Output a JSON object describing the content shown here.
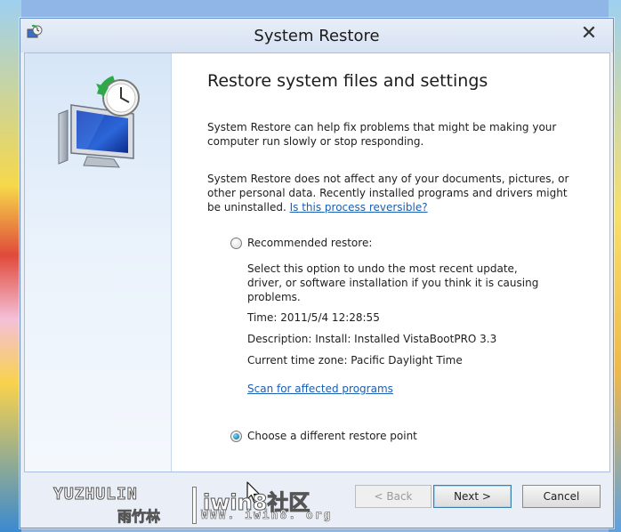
{
  "window": {
    "title": "System Restore",
    "close_label": "✕"
  },
  "main": {
    "heading": "Restore system files and settings",
    "paragraph1": "System Restore can help fix problems that might be making your computer run slowly or stop responding.",
    "paragraph2": "System Restore does not affect any of your documents, pictures, or other personal data. Recently installed programs and drivers might be uninstalled.",
    "reversible_link": "Is this process reversible?"
  },
  "recommended": {
    "label": "Recommended restore:",
    "checked": false,
    "description": "Select this option to undo the most recent update, driver, or software installation if you think it is causing problems.",
    "time": "Time: 2011/5/4 12:28:55",
    "detail": "Description: Install: Installed VistaBootPRO 3.3",
    "timezone": "Current time zone: Pacific Daylight Time",
    "scan_link": "Scan for affected programs"
  },
  "alternate": {
    "label": "Choose a different restore point",
    "checked": true
  },
  "buttons": {
    "back": "< Back",
    "next": "Next >",
    "cancel": "Cancel"
  },
  "watermark": {
    "latin": "YUZHULIN",
    "chinese": "雨竹林",
    "domain": "iwin8社区",
    "url": "WWW. iwin8. org"
  },
  "colors": {
    "link": "#1a5fb4",
    "accent": "#3c7fb1"
  },
  "icons": {
    "app": "system-restore-icon",
    "hero": "monitor-clock-restore-icon",
    "cursor": "mouse-pointer-icon"
  }
}
